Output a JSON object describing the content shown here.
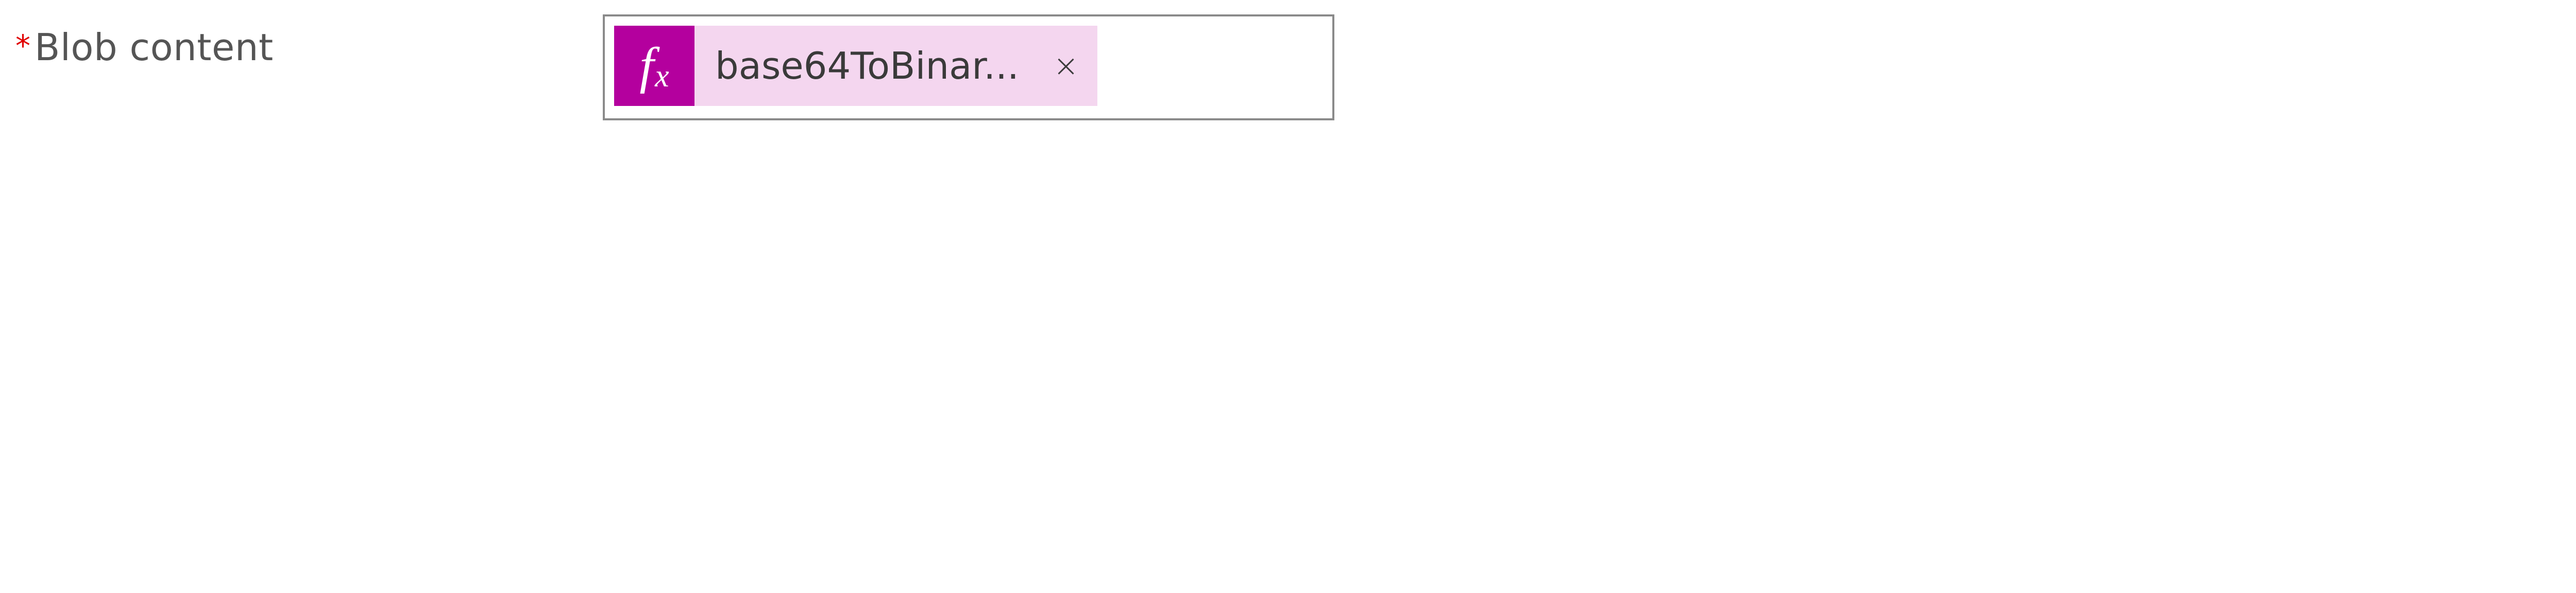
{
  "field": {
    "required_marker": "*",
    "label": "Blob content"
  },
  "token": {
    "icon_name": "fx",
    "display_text": "base64ToBinar...",
    "remove_glyph": "×"
  },
  "colors": {
    "accent": "#b4009e",
    "token_bg": "#f4d6ef",
    "border": "#8a8a8a",
    "required": "#e00000"
  }
}
